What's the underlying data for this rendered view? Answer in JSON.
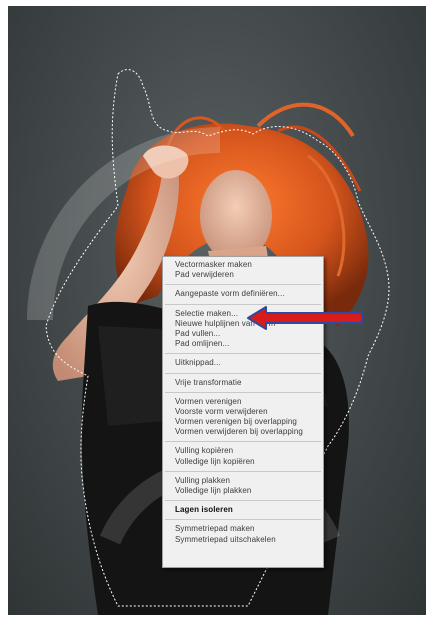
{
  "colors": {
    "background": "#464c4e",
    "hair": "#d4541c",
    "skin": "#e8b8a0",
    "dress": "#141414",
    "menu_bg": "#f0f0f0",
    "arrow_fill": "#d81c1c",
    "arrow_outline": "#2b4aa0"
  },
  "context_menu": {
    "groups": [
      {
        "items": [
          "Vectormasker maken",
          "Pad verwijderen"
        ]
      },
      {
        "items": [
          "Aangepaste vorm definiëren..."
        ]
      },
      {
        "items": [
          "Selectie maken...",
          "Nieuwe hulplijnen van vorm",
          "Pad vullen...",
          "Pad omlijnen..."
        ]
      },
      {
        "items": [
          "Uitknippad..."
        ]
      },
      {
        "items": [
          "Vrije transformatie"
        ]
      },
      {
        "items": [
          "Vormen verenigen",
          "Voorste vorm verwijderen",
          "Vormen verenigen bij overlapping",
          "Vormen verwijderen bij overlapping"
        ]
      },
      {
        "items": [
          "Vulling kopiëren",
          "Volledige lijn kopiëren"
        ]
      },
      {
        "items": [
          "Vulling plakken",
          "Volledige lijn plakken"
        ]
      },
      {
        "items": [
          "Lagen isoleren"
        ]
      },
      {
        "items": [
          "Symmetriepad maken",
          "Symmetriepad uitschakelen"
        ]
      }
    ]
  },
  "icons": {
    "arrow": "left-arrow-icon"
  }
}
